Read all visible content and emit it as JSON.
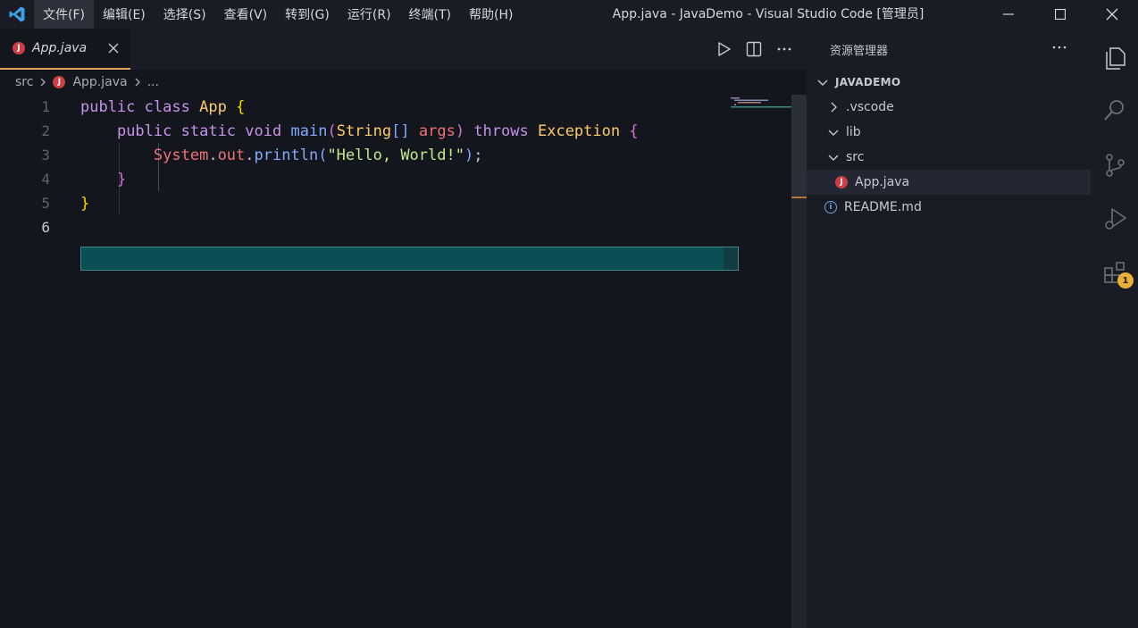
{
  "window": {
    "title": "App.java - JavaDemo - Visual Studio Code [管理员]"
  },
  "menu": {
    "items": [
      {
        "label": "文件(F)"
      },
      {
        "label": "编辑(E)"
      },
      {
        "label": "选择(S)"
      },
      {
        "label": "查看(V)"
      },
      {
        "label": "转到(G)"
      },
      {
        "label": "运行(R)"
      },
      {
        "label": "终端(T)"
      },
      {
        "label": "帮助(H)"
      }
    ]
  },
  "tab": {
    "label": "App.java",
    "icon_letter": "J"
  },
  "breadcrumb": {
    "folder": "src",
    "file": "App.java",
    "ellipsis": "..."
  },
  "editor": {
    "line_numbers": [
      "1",
      "2",
      "3",
      "4",
      "5",
      "6"
    ],
    "current_line": "6"
  },
  "sidebar": {
    "title": "资源管理器",
    "section": "JAVADEMO",
    "items": [
      {
        "label": ".vscode"
      },
      {
        "label": "lib"
      },
      {
        "label": "src"
      },
      {
        "label": "App.java"
      },
      {
        "label": "README.md"
      }
    ]
  },
  "activity": {
    "extensions_badge": "1"
  },
  "colors": {
    "accent_tab": "#e0a45c",
    "java_icon": "#cc3e44",
    "badge": "#e9b033",
    "current_line": "#0b4f55"
  }
}
